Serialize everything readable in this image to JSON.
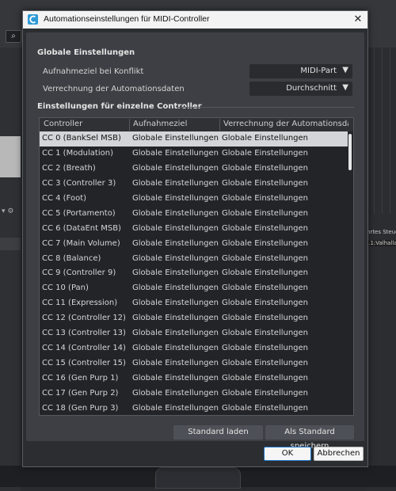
{
  "background": {
    "right_text_1": "nrtes Steue",
    "right_text_2": "..1:Valhalla",
    "search_icon": "search-icon",
    "gear_icon": "gear-icon"
  },
  "dialog": {
    "title": "Automationseinstellungen für MIDI-Controller",
    "close_label": "✕",
    "global_heading": "Globale Einstellungen",
    "conflict_label": "Aufnahmeziel bei Konflikt",
    "conflict_value": "MIDI-Part",
    "calc_label": "Verrechnung der Automationsdaten",
    "calc_value": "Durchschnitt",
    "single_heading": "Einstellungen für einzelne Controller",
    "table": {
      "columns": [
        "Controller",
        "Aufnahmeziel",
        "Verrechnung der Automationsdaten"
      ],
      "rows": [
        [
          "CC 0  (BankSel MSB)",
          "Globale Einstellungen",
          "Globale Einstellungen"
        ],
        [
          "CC 1  (Modulation)",
          "Globale Einstellungen",
          "Globale Einstellungen"
        ],
        [
          "CC 2  (Breath)",
          "Globale Einstellungen",
          "Globale Einstellungen"
        ],
        [
          "CC 3  (Controller 3)",
          "Globale Einstellungen",
          "Globale Einstellungen"
        ],
        [
          "CC 4  (Foot)",
          "Globale Einstellungen",
          "Globale Einstellungen"
        ],
        [
          "CC 5  (Portamento)",
          "Globale Einstellungen",
          "Globale Einstellungen"
        ],
        [
          "CC 6  (DataEnt MSB)",
          "Globale Einstellungen",
          "Globale Einstellungen"
        ],
        [
          "CC 7  (Main Volume)",
          "Globale Einstellungen",
          "Globale Einstellungen"
        ],
        [
          "CC 8  (Balance)",
          "Globale Einstellungen",
          "Globale Einstellungen"
        ],
        [
          "CC 9  (Controller 9)",
          "Globale Einstellungen",
          "Globale Einstellungen"
        ],
        [
          "CC 10  (Pan)",
          "Globale Einstellungen",
          "Globale Einstellungen"
        ],
        [
          "CC 11  (Expression)",
          "Globale Einstellungen",
          "Globale Einstellungen"
        ],
        [
          "CC 12  (Controller 12)",
          "Globale Einstellungen",
          "Globale Einstellungen"
        ],
        [
          "CC 13  (Controller 13)",
          "Globale Einstellungen",
          "Globale Einstellungen"
        ],
        [
          "CC 14  (Controller 14)",
          "Globale Einstellungen",
          "Globale Einstellungen"
        ],
        [
          "CC 15  (Controller 15)",
          "Globale Einstellungen",
          "Globale Einstellungen"
        ],
        [
          "CC 16  (Gen Purp 1)",
          "Globale Einstellungen",
          "Globale Einstellungen"
        ],
        [
          "CC 17  (Gen Purp 2)",
          "Globale Einstellungen",
          "Globale Einstellungen"
        ],
        [
          "CC 18  (Gen Purp 3)",
          "Globale Einstellungen",
          "Globale Einstellungen"
        ]
      ],
      "selected_row": 0
    },
    "load_default_label": "Standard laden",
    "save_default_label": "Als Standard speichern",
    "ok_label": "OK",
    "cancel_label": "Abbrechen",
    "accent_color": "#1a73c8"
  }
}
